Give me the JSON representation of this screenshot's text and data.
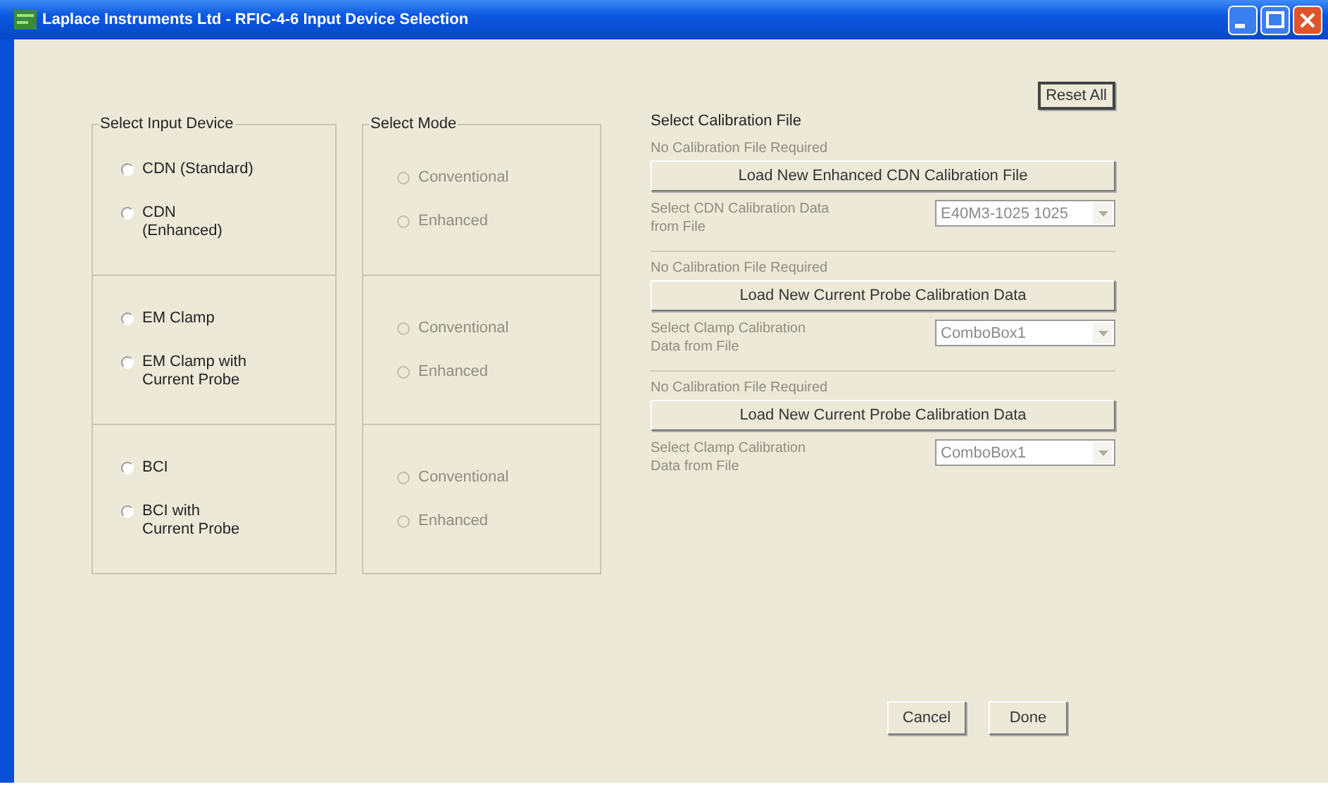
{
  "window": {
    "title": "Laplace Instruments Ltd - RFIC-4-6 Input Device Selection"
  },
  "device_group": {
    "title": "Select Input Device",
    "sections": [
      {
        "options": [
          {
            "label": "CDN (Standard)",
            "selected": false,
            "disabled": false
          },
          {
            "label": "CDN (Enhanced)",
            "selected": false,
            "disabled": false
          }
        ]
      },
      {
        "options": [
          {
            "label": "EM Clamp",
            "selected": false,
            "disabled": false
          },
          {
            "label": "EM Clamp with Current Probe",
            "selected": false,
            "disabled": false
          }
        ]
      },
      {
        "options": [
          {
            "label": "BCI",
            "selected": false,
            "disabled": false
          },
          {
            "label": "BCI with Current Probe",
            "selected": false,
            "disabled": false
          }
        ]
      }
    ]
  },
  "mode_group": {
    "title": "Select Mode",
    "sections": [
      {
        "options": [
          {
            "label": "Conventional",
            "selected": false,
            "disabled": true
          },
          {
            "label": "Enhanced",
            "selected": false,
            "disabled": true
          }
        ]
      },
      {
        "options": [
          {
            "label": "Conventional",
            "selected": false,
            "disabled": true
          },
          {
            "label": "Enhanced",
            "selected": false,
            "disabled": true
          }
        ]
      },
      {
        "options": [
          {
            "label": "Conventional",
            "selected": false,
            "disabled": true
          },
          {
            "label": "Enhanced",
            "selected": false,
            "disabled": true
          }
        ]
      }
    ]
  },
  "calibration": {
    "title": "Select Calibration File",
    "reset_button": "Reset All",
    "sections": [
      {
        "status": "No Calibration File Required",
        "load_button": "Load New Enhanced CDN Calibration File",
        "select_label": "Select CDN Calibration Data from File",
        "combo_value": "E40M3-1025 1025",
        "disabled": true
      },
      {
        "status": "No Calibration File Required",
        "load_button": "Load New Current Probe Calibration Data",
        "select_label": "Select Clamp Calibration Data from File",
        "combo_value": "ComboBox1",
        "disabled": true
      },
      {
        "status": "No Calibration File Required",
        "load_button": "Load New Current Probe Calibration Data",
        "select_label": "Select Clamp Calibration Data from File",
        "combo_value": "ComboBox1",
        "disabled": true
      }
    ]
  },
  "buttons": [
    "Cancel",
    "Done"
  ]
}
